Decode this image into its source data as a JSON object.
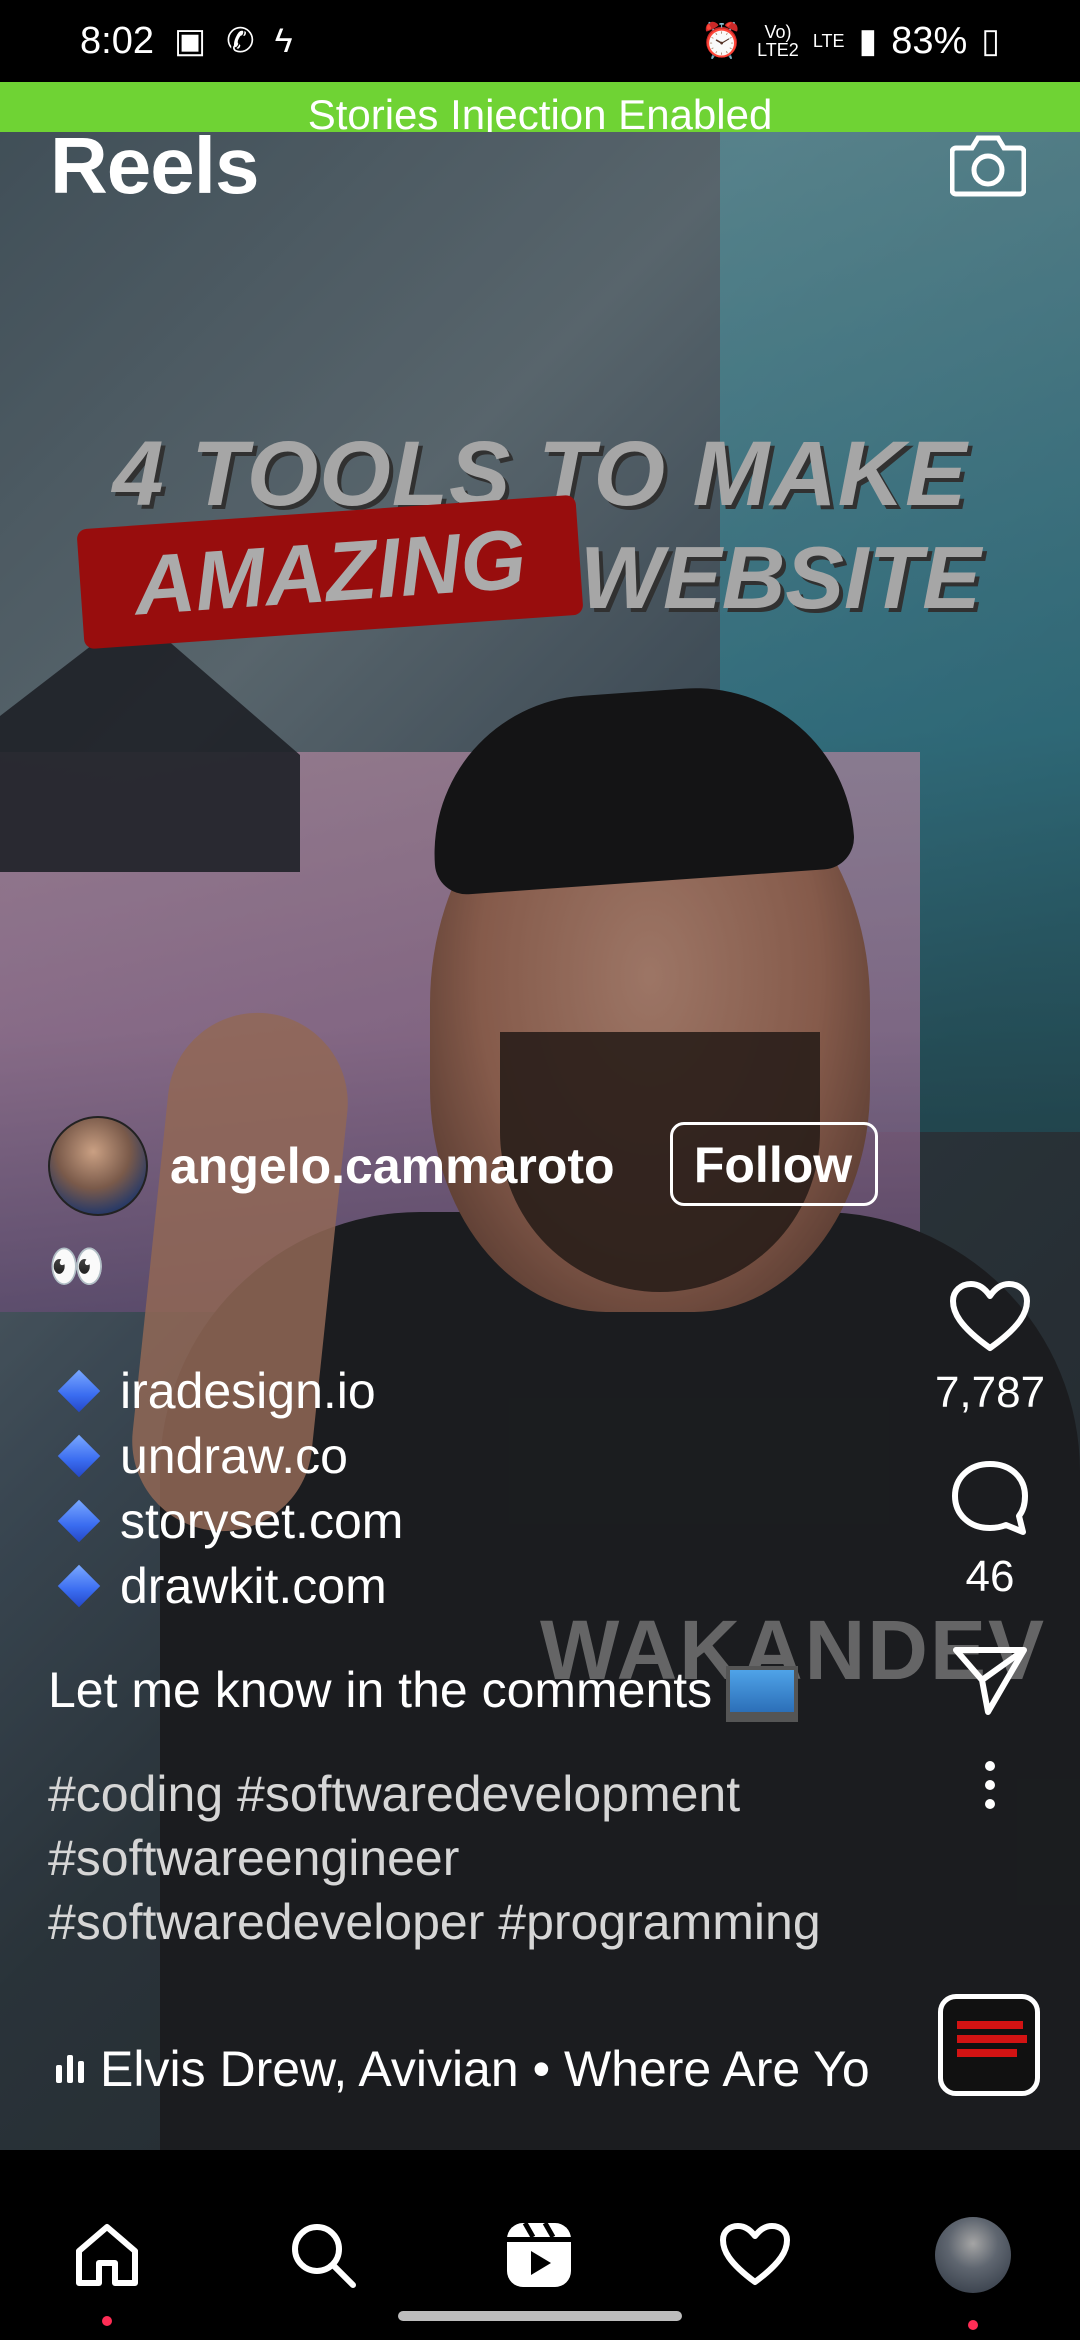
{
  "status_bar": {
    "time": "8:02",
    "battery": "83%",
    "network": "LTE",
    "icons_left": [
      "gallery-icon",
      "whatsapp-icon",
      "bolt-icon"
    ],
    "icons_right": [
      "alarm-icon",
      "volte-icon",
      "lte-icon",
      "signal-icon",
      "battery-icon"
    ]
  },
  "banner": {
    "text": "Stories Injection Enabled",
    "color": "#6fd334"
  },
  "header": {
    "title": "Reels"
  },
  "video_overlay": {
    "line1": "4 TOOLS TO MAKE",
    "highlight": "AMAZING",
    "line2": "WEBSITE",
    "hoodie_text": "WAKANDEV"
  },
  "post": {
    "username": "angelo.cammaroto",
    "follow_label": "Follow",
    "caption_emoji": "👀",
    "links": [
      "iradesign.io",
      "undraw.co",
      "storyset.com",
      "drawkit.com"
    ],
    "caption_note": "Let me know in the comments",
    "hashtags": [
      "#coding #softwaredevelopment",
      "#softwareengineer",
      "#softwaredeveloper #programming"
    ]
  },
  "actions": {
    "likes": "7,787",
    "comments": "46"
  },
  "audio": {
    "label": "Elvis Drew, Avivian • Where Are Yo"
  },
  "nav": {
    "items": [
      "home-icon",
      "search-icon",
      "reels-icon",
      "heart-icon",
      "profile-avatar"
    ]
  },
  "colors": {
    "accent_red": "#d31313",
    "notification_dot": "#ff2d55"
  }
}
